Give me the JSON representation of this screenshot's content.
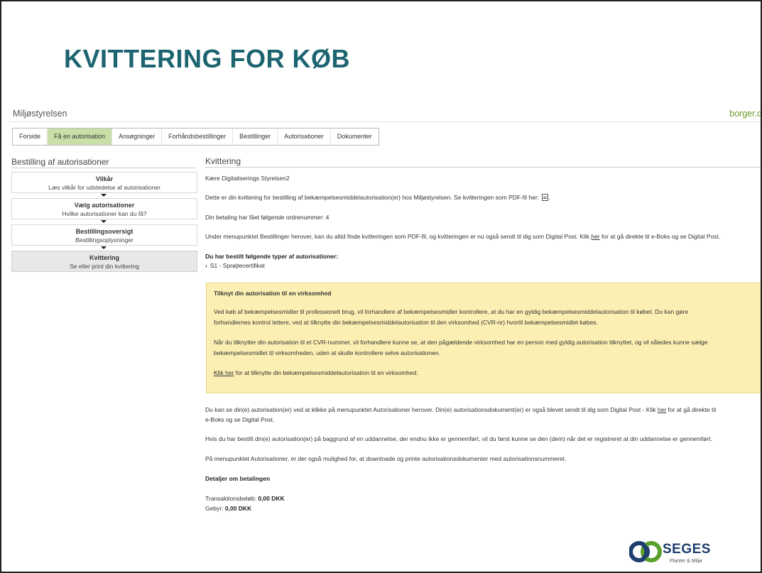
{
  "slide": {
    "title": "KVITTERING FOR KØB"
  },
  "site": {
    "name": "Miljøstyrelsen",
    "borger_link": "borger.d"
  },
  "tabs": [
    {
      "label": "Forside",
      "active": false
    },
    {
      "label": "Få en autorisation",
      "active": true
    },
    {
      "label": "Ansøgninger",
      "active": false
    },
    {
      "label": "Forhåndsbestillinger",
      "active": false
    },
    {
      "label": "Bestillinger",
      "active": false
    },
    {
      "label": "Autorisationer",
      "active": false
    },
    {
      "label": "Dokumenter",
      "active": false
    }
  ],
  "sidebar": {
    "title": "Bestilling af autorisationer",
    "steps": [
      {
        "title": "Vilkår",
        "subtitle": "Læs vilkår for udstedelse af autorisationer",
        "active": false
      },
      {
        "title": "Vælg autorisationer",
        "subtitle": "Hvilke autorisationer kan du få?",
        "active": false
      },
      {
        "title": "Bestillingsoversigt",
        "subtitle": "Bestillingsoplysninger",
        "active": false
      },
      {
        "title": "Kvittering",
        "subtitle": "Se eller print din kvittering",
        "active": true
      }
    ]
  },
  "main": {
    "title": "Kvittering",
    "greeting": "Kære Digitaliserings Styrelsen2",
    "intro": "Dette er din kvittering for bestilling af bekæmpelsesmiddelautorisation(er) hos Miljøstyrelsen. Se kvitteringen som PDF-fil her:",
    "order_number_text": "Din betaling har fået følgende ordrenummer: 4",
    "menu_info_before": "Under menupunktet Bestillinger herover, kan du altid finde kvitteringen som PDF-fil, og kvitteringen er nu også sendt til dig som Digital Post. Klik",
    "menu_info_link": "her",
    "menu_info_after": "for at gå direkte til e-Boks og se Digital Post.",
    "ordered_heading": "Du har bestilt følgende typer af autorisationer:",
    "ordered_item": "S1 - Sprøjtecertifikat",
    "notice": {
      "heading": "Tilknyt din autorisation til en virksomhed",
      "para1_line1": "Ved køb af bekæmpelsesmidler til professionelt brug, vil forhandlere af bekæmpelsesmidler kontrollere, at du har en gyldig bekæmpelsesmiddelautorisation til købet. Du kan gøre",
      "para1_line2": "forhandlernes kontrol lettere, ved at tilknytte din bekæmpelsesmiddelautorisation til den virksomhed (CVR-nr) hvortil bekæmpelsesmidlet købes.",
      "para2_line1": "Når du tilknytter din autorisation til et CVR-nummer, vil forhandlere kunne se, at den pågældende virksomhed har en person med gyldig autorisation tilknyttet, og vil således kunne sælge",
      "para2_line2": "bekæmpelsesmidlet til virksomheden, uden at skulle kontrollere selve autorisationen.",
      "link_text": "Klik her",
      "link_after": "for at tilknytte din bekæmpelsesmiddelautorisation til en virksomhed."
    },
    "auth_info_line1_before": "Du kan se din(e) autorisation(er) ved at klikke på menupunktet Autorisationer herover. Din(e) autorisationsdokument(er) er også blevet sendt til dig som Digital Post - Klik",
    "auth_info_link": "her",
    "auth_info_line1_after": "for at gå direkte til",
    "auth_info_line2": "e-Boks og se Digital Post.",
    "education_info": "Hvis du har bestilt din(e) autorisation(er) på baggrund af en uddannelse, der endnu ikke er gennemført, vil du først kunne se den (dem) når det er registreret at din uddannelse er gennemført.",
    "download_info": "På menupunktet Autorisationer, er der også mulighed for, at downloade og printe autorisationsdokumenter med autorisationsnummeret.",
    "payment_heading": "Detaljer om betalingen",
    "transaction_label": "Transaktionsbeløb:",
    "transaction_value": "0,00 DKK",
    "fee_label": "Gebyr:",
    "fee_value": "0,00 DKK"
  },
  "logo": {
    "name": "SEGES",
    "subtitle": "Planter & Miljø"
  },
  "colors": {
    "title": "#1c6470",
    "active_tab": "#c9dfa8",
    "notice_bg": "#fcefb3",
    "borger_link": "#6a9a2a",
    "logo_navy": "#1e3e6e"
  }
}
